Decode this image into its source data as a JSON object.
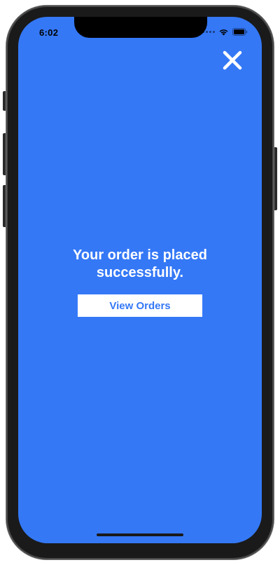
{
  "status_bar": {
    "time": "6:02",
    "wifi_icon": "wifi-icon",
    "battery_icon": "battery-icon"
  },
  "close_icon": "close-icon",
  "confirmation": {
    "message": "Your order is placed successfully.",
    "button_label": "View Orders"
  },
  "colors": {
    "background": "#3478F6",
    "button_bg": "#FFFFFF",
    "button_text": "#3478F6",
    "message_text": "#FFFFFF"
  }
}
